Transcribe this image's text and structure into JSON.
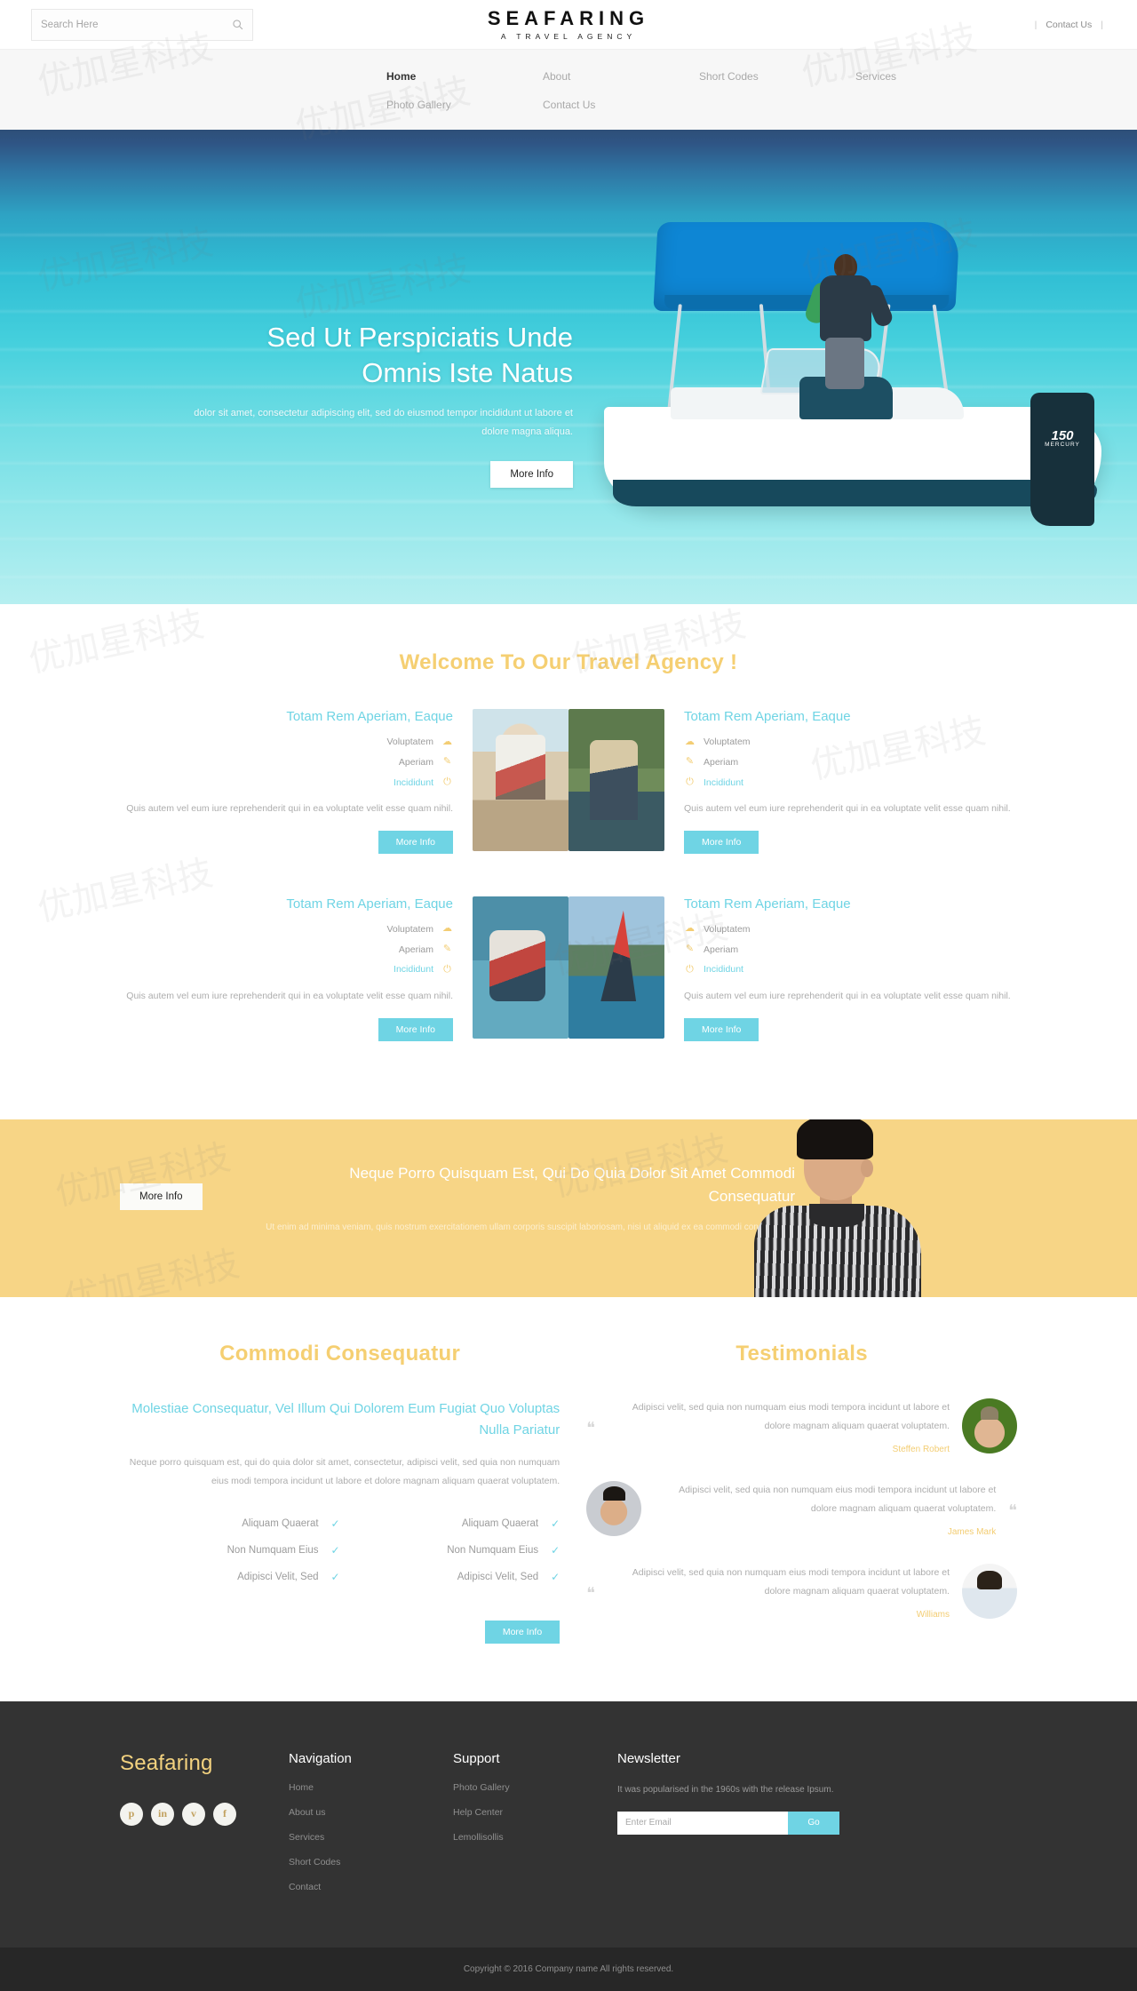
{
  "topbar": {
    "search_placeholder": "Search Here",
    "search_value": "",
    "search_icon": "search-icon",
    "brand_title": "SEAFARING",
    "brand_sub": "A TRAVEL AGENCY",
    "sep_left": "|",
    "contact_link": "Contact Us",
    "sep_right": "|"
  },
  "nav": {
    "items": [
      {
        "label": "Home",
        "active": true
      },
      {
        "label": "About",
        "active": false
      },
      {
        "label": "Short Codes",
        "active": false
      },
      {
        "label": "Services",
        "active": false
      },
      {
        "label": "Photo Gallery",
        "active": false
      },
      {
        "label": "Contact Us",
        "active": false
      }
    ]
  },
  "hero": {
    "title": "Sed Ut Perspiciatis Unde Omnis Iste Natus",
    "text": "dolor sit amet, consectetur adipiscing elit, sed do eiusmod tempor incididunt ut labore et dolore magna aliqua.",
    "button": "More Info"
  },
  "welcome": {
    "title": "Welcome To Our Travel Agency !",
    "cards": [
      {
        "title": "Totam Rem Aperiam, Eaque",
        "features": [
          {
            "label": "Voluptatem",
            "icon": "cloud-icon",
            "highlight": false
          },
          {
            "label": "Aperiam",
            "icon": "pencil-icon",
            "highlight": false
          },
          {
            "label": "Incididunt",
            "icon": "power-icon",
            "highlight": true
          }
        ],
        "desc": "Quis autem vel eum iure reprehenderit qui in ea voluptate velit esse quam nihil.",
        "button": "More Info",
        "image": "img-beach"
      },
      {
        "title": "Totam Rem Aperiam, Eaque",
        "features": [
          {
            "label": "Voluptatem",
            "icon": "cloud-icon",
            "highlight": false
          },
          {
            "label": "Aperiam",
            "icon": "pencil-icon",
            "highlight": false
          },
          {
            "label": "Incididunt",
            "icon": "power-icon",
            "highlight": true
          }
        ],
        "desc": "Quis autem vel eum iure reprehenderit qui in ea voluptate velit esse quam nihil.",
        "button": "More Info",
        "image": "img-fish"
      },
      {
        "title": "Totam Rem Aperiam, Eaque",
        "features": [
          {
            "label": "Voluptatem",
            "icon": "cloud-icon",
            "highlight": false
          },
          {
            "label": "Aperiam",
            "icon": "pencil-icon",
            "highlight": false
          },
          {
            "label": "Incididunt",
            "icon": "power-icon",
            "highlight": true
          }
        ],
        "desc": "Quis autem vel eum iure reprehenderit qui in ea voluptate velit esse quam nihil.",
        "button": "More Info",
        "image": "img-kayak"
      },
      {
        "title": "Totam Rem Aperiam, Eaque",
        "features": [
          {
            "label": "Voluptatem",
            "icon": "cloud-icon",
            "highlight": false
          },
          {
            "label": "Aperiam",
            "icon": "pencil-icon",
            "highlight": false
          },
          {
            "label": "Incididunt",
            "icon": "power-icon",
            "highlight": true
          }
        ],
        "desc": "Quis autem vel eum iure reprehenderit qui in ea voluptate velit esse quam nihil.",
        "button": "More Info",
        "image": "img-sail"
      }
    ]
  },
  "banner": {
    "button": "More Info",
    "title": "Neque Porro Quisquam Est, Qui Do Quia Dolor Sit Amet Commodi Consequatur",
    "desc": "Ut enim ad minima veniam, quis nostrum exercitationem ullam corporis suscipit laboriosam, nisi ut aliquid ex ea commodi consequatur."
  },
  "commodi": {
    "title": "Commodi Consequatur",
    "subtitle": "Molestiae Consequatur, Vel Illum Qui Dolorem Eum Fugiat Quo Voluptas Nulla Pariatur",
    "desc": "Neque porro quisquam est, qui do quia dolor sit amet, consectetur, adipisci velit, sed quia non numquam eius modi tempora incidunt ut labore et dolore magnam aliquam quaerat voluptatem.",
    "checks_col1": [
      "Aliquam Quaerat",
      "Non Numquam Eius",
      "Adipisci Velit, Sed"
    ],
    "checks_col2": [
      "Aliquam Quaerat",
      "Non Numquam Eius",
      "Adipisci Velit, Sed"
    ],
    "check_icon": "check-icon",
    "button": "More Info"
  },
  "testimonials": {
    "title": "Testimonials",
    "quote_icon": "quote-icon",
    "items": [
      {
        "text": "Adipisci velit, sed quia non numquam eius modi tempora incidunt ut labore et dolore magnam aliquam quaerat voluptatem.",
        "name": "Steffen Robert",
        "avatar": "ava-1",
        "reversed": false
      },
      {
        "text": "Adipisci velit, sed quia non numquam eius modi tempora incidunt ut labore et dolore magnam aliquam quaerat voluptatem.",
        "name": "James Mark",
        "avatar": "ava-2",
        "reversed": true
      },
      {
        "text": "Adipisci velit, sed quia non numquam eius modi tempora incidunt ut labore et dolore magnam aliquam quaerat voluptatem.",
        "name": "Williams",
        "avatar": "ava-3",
        "reversed": false
      }
    ]
  },
  "footer": {
    "brand": "Seafaring",
    "socials": [
      {
        "name": "pinterest-icon",
        "glyph": "p"
      },
      {
        "name": "linkedin-icon",
        "glyph": "in"
      },
      {
        "name": "vimeo-icon",
        "glyph": "v"
      },
      {
        "name": "facebook-icon",
        "glyph": "f"
      }
    ],
    "nav_head": "Navigation",
    "nav_links": [
      "Home",
      "About us",
      "Services",
      "Short Codes",
      "Contact"
    ],
    "support_head": "Support",
    "support_links": [
      "Photo Gallery",
      "Help Center",
      "Lemollisollis"
    ],
    "news_head": "Newsletter",
    "news_text": "It was popularised in the 1960s with the release Ipsum.",
    "news_placeholder": "Enter Email",
    "news_value": "",
    "news_button": "Go",
    "copyright": "Copyright © 2016 Company name All rights reserved."
  },
  "colors": {
    "accent_yellow": "#f5cf72",
    "accent_cyan": "#6fd4e4",
    "banner_yellow": "#f7d586",
    "footer_dark": "#333333",
    "copyright_dark": "#272727"
  },
  "watermark": "优加星科技"
}
